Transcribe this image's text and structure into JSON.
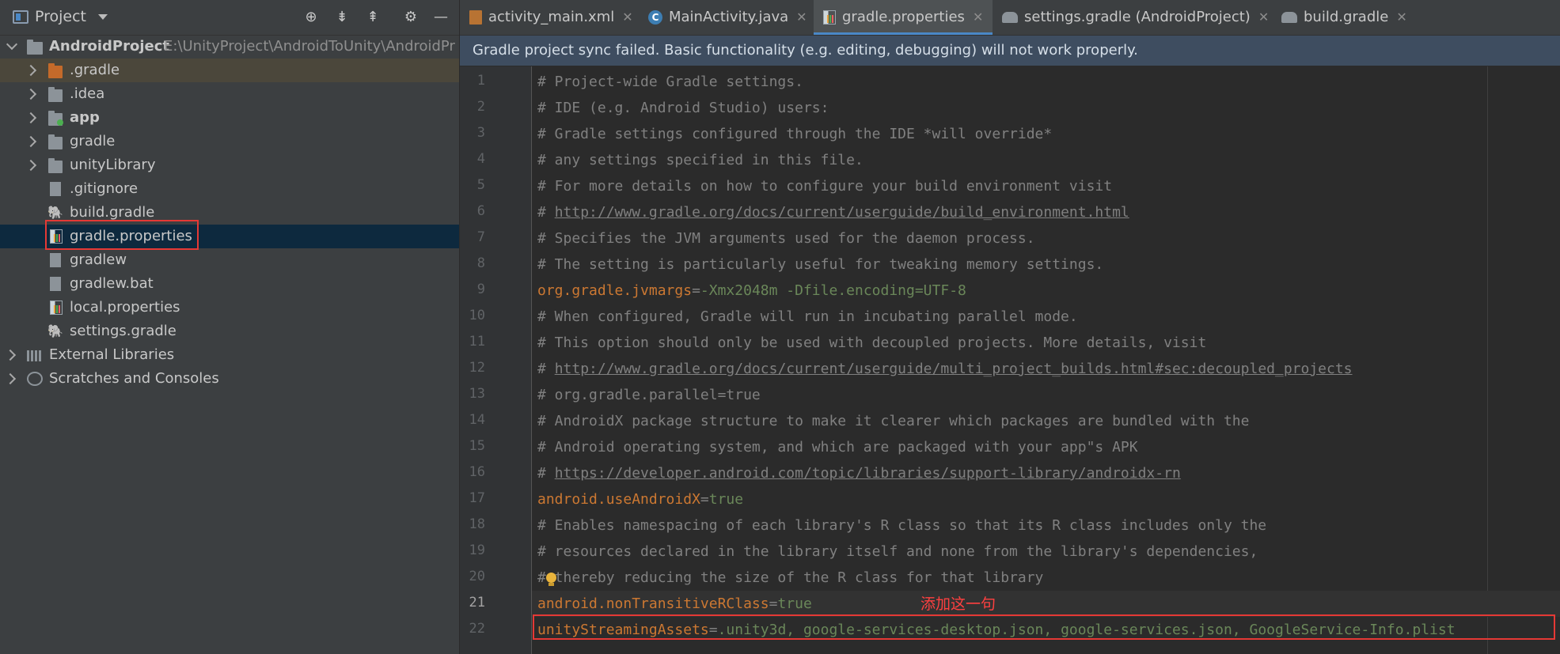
{
  "project_panel": {
    "title": "Project",
    "root": {
      "name": "AndroidProject",
      "path": "E:\\UnityProject\\AndroidToUnity\\AndroidPr"
    },
    "items": [
      {
        "label": ".gradle",
        "type": "folder-excluded",
        "expandable": true
      },
      {
        "label": ".idea",
        "type": "folder",
        "expandable": true
      },
      {
        "label": "app",
        "type": "module",
        "expandable": true
      },
      {
        "label": "gradle",
        "type": "folder",
        "expandable": true
      },
      {
        "label": "unityLibrary",
        "type": "folder",
        "expandable": true
      },
      {
        "label": ".gitignore",
        "type": "file",
        "expandable": false
      },
      {
        "label": "build.gradle",
        "type": "gradle",
        "expandable": false
      },
      {
        "label": "gradle.properties",
        "type": "properties",
        "expandable": false
      },
      {
        "label": "gradlew",
        "type": "file",
        "expandable": false
      },
      {
        "label": "gradlew.bat",
        "type": "file",
        "expandable": false
      },
      {
        "label": "local.properties",
        "type": "properties",
        "expandable": false
      },
      {
        "label": "settings.gradle",
        "type": "gradle",
        "expandable": false
      }
    ],
    "external_libraries": "External Libraries",
    "scratches": "Scratches and Consoles"
  },
  "tabs": [
    {
      "label": "activity_main.xml",
      "icon": "xml-file-icon"
    },
    {
      "label": "MainActivity.java",
      "icon": "java-class-icon"
    },
    {
      "label": "gradle.properties",
      "icon": "properties-file-icon",
      "active": true
    },
    {
      "label": "settings.gradle (AndroidProject)",
      "icon": "gradle-icon"
    },
    {
      "label": "build.gradle",
      "icon": "gradle-icon"
    }
  ],
  "banner": "Gradle project sync failed. Basic functionality (e.g. editing, debugging) will not work properly.",
  "editor": {
    "current_line": 21,
    "annotation": "添加这一句",
    "lines": [
      {
        "n": "1",
        "c": "# Project-wide Gradle settings."
      },
      {
        "n": "2",
        "c": "# IDE (e.g. Android Studio) users:"
      },
      {
        "n": "3",
        "c": "# Gradle settings configured through the IDE *will override*"
      },
      {
        "n": "4",
        "c": "# any settings specified in this file."
      },
      {
        "n": "5",
        "c": "# For more details on how to configure your build environment visit"
      },
      {
        "n": "6",
        "p": "# ",
        "u": "http://www.gradle.org/docs/current/userguide/build_environment.html"
      },
      {
        "n": "7",
        "c": "# Specifies the JVM arguments used for the daemon process."
      },
      {
        "n": "8",
        "c": "# The setting is particularly useful for tweaking memory settings."
      },
      {
        "n": "9",
        "k": "org.gradle.jvmargs",
        "v": "-Xmx2048m -Dfile.encoding=UTF-8"
      },
      {
        "n": "10",
        "c": "# When configured, Gradle will run in incubating parallel mode."
      },
      {
        "n": "11",
        "c": "# This option should only be used with decoupled projects. More details, visit"
      },
      {
        "n": "12",
        "p": "# ",
        "u": "http://www.gradle.org/docs/current/userguide/multi_project_builds.html#sec:decoupled_projects"
      },
      {
        "n": "13",
        "c": "# org.gradle.parallel=true"
      },
      {
        "n": "14",
        "c": "# AndroidX package structure to make it clearer which packages are bundled with the"
      },
      {
        "n": "15",
        "c": "# Android operating system, and which are packaged with your app\"s APK"
      },
      {
        "n": "16",
        "p": "# ",
        "u": "https://developer.android.com/topic/libraries/support-library/androidx-rn"
      },
      {
        "n": "17",
        "k": "android.useAndroidX",
        "v": "true"
      },
      {
        "n": "18",
        "c": "# Enables namespacing of each library's R class so that its R class includes only the"
      },
      {
        "n": "19",
        "c": "# resources declared in the library itself and none from the library's dependencies,"
      },
      {
        "n": "20",
        "c": "# thereby reducing the size of the R class for that library"
      },
      {
        "n": "21",
        "k": "android.nonTransitiveRClass",
        "v": "true"
      },
      {
        "n": "22",
        "k": "unityStreamingAssets",
        "v": ".unity3d, google-services-desktop.json, google-services.json, GoogleService-Info.plist"
      }
    ]
  }
}
